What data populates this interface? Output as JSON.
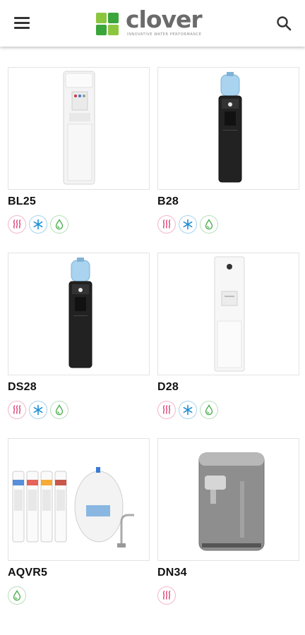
{
  "brand": {
    "name": "clover",
    "tagline": "INNOVATIVE WATER PERFORMANCE",
    "colors": {
      "green_light": "#8cc63f",
      "green_dark": "#3aa53a",
      "text": "#6b6b6b"
    }
  },
  "header": {
    "menu_icon": "hamburger-menu-icon",
    "search_icon": "search-icon"
  },
  "feature_colors": {
    "hot": "#e0457b",
    "cold": "#1d8fd6",
    "ambient": "#4caf50"
  },
  "products": [
    {
      "name": "BL25",
      "image": "white-floor-water-dispenser",
      "features": [
        "hot",
        "cold",
        "ambient"
      ]
    },
    {
      "name": "B28",
      "image": "black-bottle-water-cooler",
      "features": [
        "hot",
        "cold",
        "ambient"
      ]
    },
    {
      "name": "DS28",
      "image": "black-bottle-water-cooler",
      "features": [
        "hot",
        "cold",
        "ambient"
      ]
    },
    {
      "name": "D28",
      "image": "white-slim-water-dispenser",
      "features": [
        "hot",
        "cold",
        "ambient"
      ]
    },
    {
      "name": "AQVR5",
      "image": "reverse-osmosis-filter-kit",
      "features": [
        "ambient"
      ]
    },
    {
      "name": "DN34",
      "image": "countertop-water-purifier",
      "features": [
        "hot"
      ]
    }
  ]
}
